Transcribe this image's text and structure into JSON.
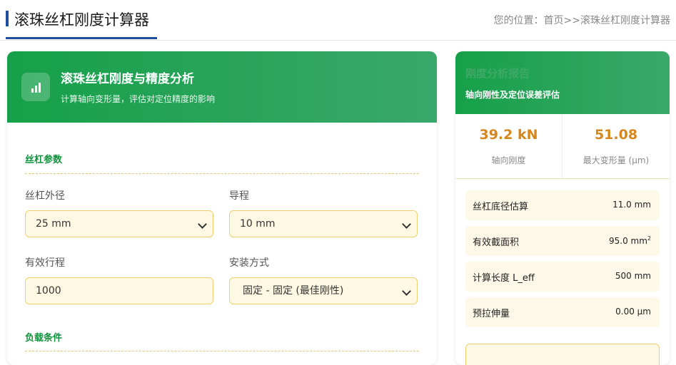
{
  "header": {
    "title": "滚珠丝杠刚度计算器",
    "breadcrumb": {
      "prefix": "您的位置：",
      "home": "首页",
      "sep": ">>",
      "current": "滚珠丝杠刚度计算器"
    }
  },
  "panel": {
    "title": "滚珠丝杠刚度与精度分析",
    "subtitle": "计算轴向变形量，评估对定位精度的影响",
    "icon": "bar-chart-icon",
    "section1": "丝杠参数",
    "fields": {
      "diameter": {
        "label": "丝杠外径",
        "value": "25 mm"
      },
      "lead": {
        "label": "导程",
        "value": "10 mm"
      },
      "stroke": {
        "label": "有效行程",
        "value": "1000"
      },
      "mount": {
        "label": "安装方式",
        "value": "固定 - 固定 (最佳刚性)"
      }
    },
    "section2": "负载条件"
  },
  "report": {
    "title": "刚度分析报告",
    "subtitle": "轴向刚性及定位误差评估",
    "metrics": [
      {
        "value": "39.2 kN",
        "label": "轴向刚度"
      },
      {
        "value": "51.08",
        "label": "最大变形量 (μm)"
      }
    ],
    "rows": [
      {
        "key": "丝杠底径估算",
        "value": "11.0 mm"
      },
      {
        "key": "有效截面积",
        "value": "95.0 mm",
        "sup": "2"
      },
      {
        "key": "计算长度 L_eff",
        "value": "500 mm"
      },
      {
        "key": "预拉伸量",
        "value": "0.00 μm"
      }
    ]
  },
  "colors": {
    "accent": "#16a049",
    "brand": "#1d4e9e",
    "highlight": "#d6861a",
    "field_bg": "#fff9e3"
  }
}
